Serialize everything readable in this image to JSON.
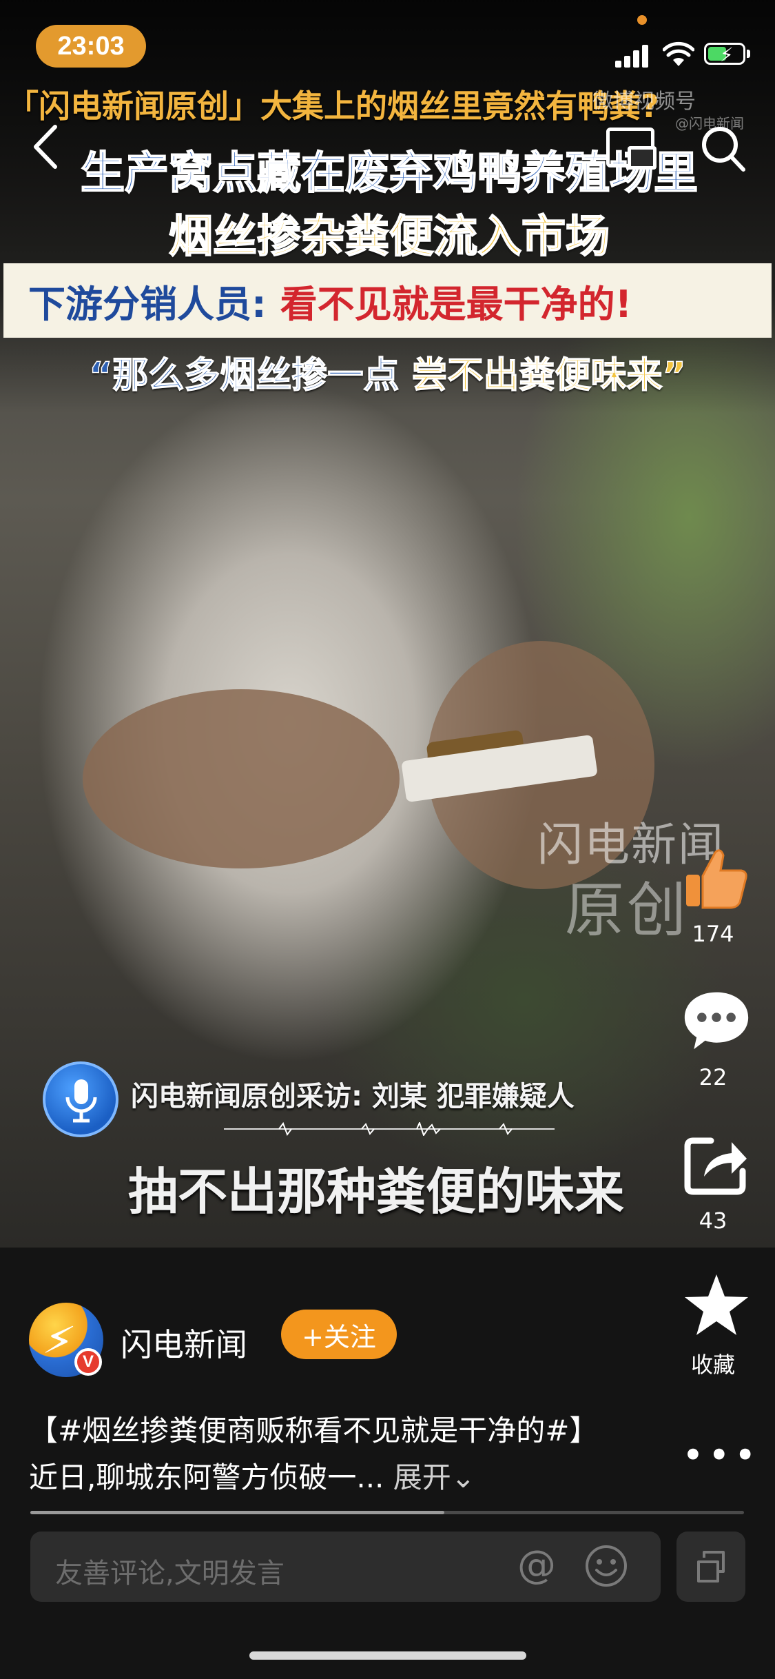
{
  "status_bar": {
    "time": "23:03"
  },
  "video": {
    "caption_top": "「闪电新闻原创」大集上的烟丝里竟然有鸭粪?",
    "watermark_top": "微博视频号",
    "watermark_top_small": "@闪电新闻",
    "headline_line1": "生产窝点藏在废弃鸡鸭养殖场里",
    "headline_line2": "烟丝掺杂粪便流入市场",
    "bar_left": "下游分销人员:",
    "bar_right": "看不见就是最干净的!",
    "quote_part1": "“那么多烟丝掺一点",
    "quote_part2": "尝不出粪便味来”",
    "watermark_mid_line1": "闪电新闻",
    "watermark_mid_line2": "原创",
    "interview_label": "闪电新闻原创采访: 刘某 犯罪嫌疑人",
    "subtitle": "抽不出那种粪便的味来"
  },
  "actions": {
    "like_count": "174",
    "comment_count": "22",
    "share_count": "43",
    "collect_label": "收藏"
  },
  "author": {
    "name": "闪电新闻",
    "follow_label": "+关注"
  },
  "description": {
    "text": "【#烟丝掺粪便商贩称看不见就是干净的#】近日,聊城东阿警方侦破一...",
    "more_label": "展开⌄"
  },
  "progress": {
    "played_fraction": 0.58
  },
  "comment_bar": {
    "placeholder": "友善评论,文明发言"
  },
  "icons": [
    "back-icon",
    "pip-icon",
    "search-icon",
    "like-icon",
    "comment-icon",
    "share-icon",
    "star-icon",
    "more-icon",
    "at-icon",
    "emoji-icon",
    "expand-icon",
    "mic-icon"
  ],
  "colors": {
    "accent": "#f3961d",
    "time_pill": "#e39a2e",
    "headline_blue": "#2a5fb8",
    "headline_yellow": "#f1c23c",
    "red_text": "#d3262e"
  }
}
